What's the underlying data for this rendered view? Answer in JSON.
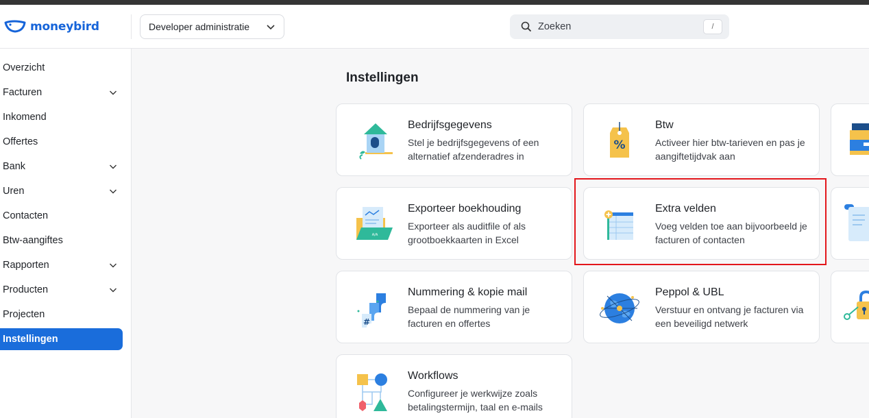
{
  "header": {
    "logo_text": "moneybird",
    "admin_select": "Developer administratie",
    "search_placeholder": "Zoeken",
    "search_shortcut": "/"
  },
  "sidebar": {
    "items": [
      {
        "label": "Overzicht",
        "has_chevron": false
      },
      {
        "label": "Facturen",
        "has_chevron": true
      },
      {
        "label": "Inkomend",
        "has_chevron": false
      },
      {
        "label": "Offertes",
        "has_chevron": false
      },
      {
        "label": "Bank",
        "has_chevron": true
      },
      {
        "label": "Uren",
        "has_chevron": true
      },
      {
        "label": "Contacten",
        "has_chevron": false
      },
      {
        "label": "Btw-aangiftes",
        "has_chevron": false
      },
      {
        "label": "Rapporten",
        "has_chevron": true
      },
      {
        "label": "Producten",
        "has_chevron": true
      },
      {
        "label": "Projecten",
        "has_chevron": false
      },
      {
        "label": "Instellingen",
        "has_chevron": false,
        "active": true
      }
    ]
  },
  "main": {
    "title": "Instellingen",
    "cards": [
      {
        "title": "Bedrijfsgegevens",
        "desc": "Stel je bedrijfsgegevens of een alternatief afzenderadres in",
        "icon": "birdhouse-icon"
      },
      {
        "title": "Btw",
        "desc": "Activeer hier btw-tarieven en pas je aangiftetijdvak aan",
        "icon": "percent-tag-icon"
      },
      {
        "title": "Exporteer boekhouding",
        "desc": "Exporteer als auditfile of als grootboekkaarten in Excel",
        "icon": "export-folder-icon"
      },
      {
        "title": "Extra velden",
        "desc": "Voeg velden toe aan bijvoorbeeld je facturen of contacten",
        "icon": "add-fields-icon"
      },
      {
        "title": "Nummering & kopie mail",
        "desc": "Bepaal de nummering van je facturen en offertes",
        "icon": "numbering-icon"
      },
      {
        "title": "Peppol & UBL",
        "desc": "Verstuur en ontvang je facturen via een beveiligd netwerk",
        "icon": "globe-network-icon"
      },
      {
        "title": "Workflows",
        "desc": "Configureer je werkwijze zoals betalingstermijn, taal en e-mails",
        "icon": "workflow-shapes-icon"
      }
    ]
  },
  "colors": {
    "brand": "#1664d9",
    "active_nav": "#1a6ddb",
    "highlight_box": "#e3161b"
  }
}
